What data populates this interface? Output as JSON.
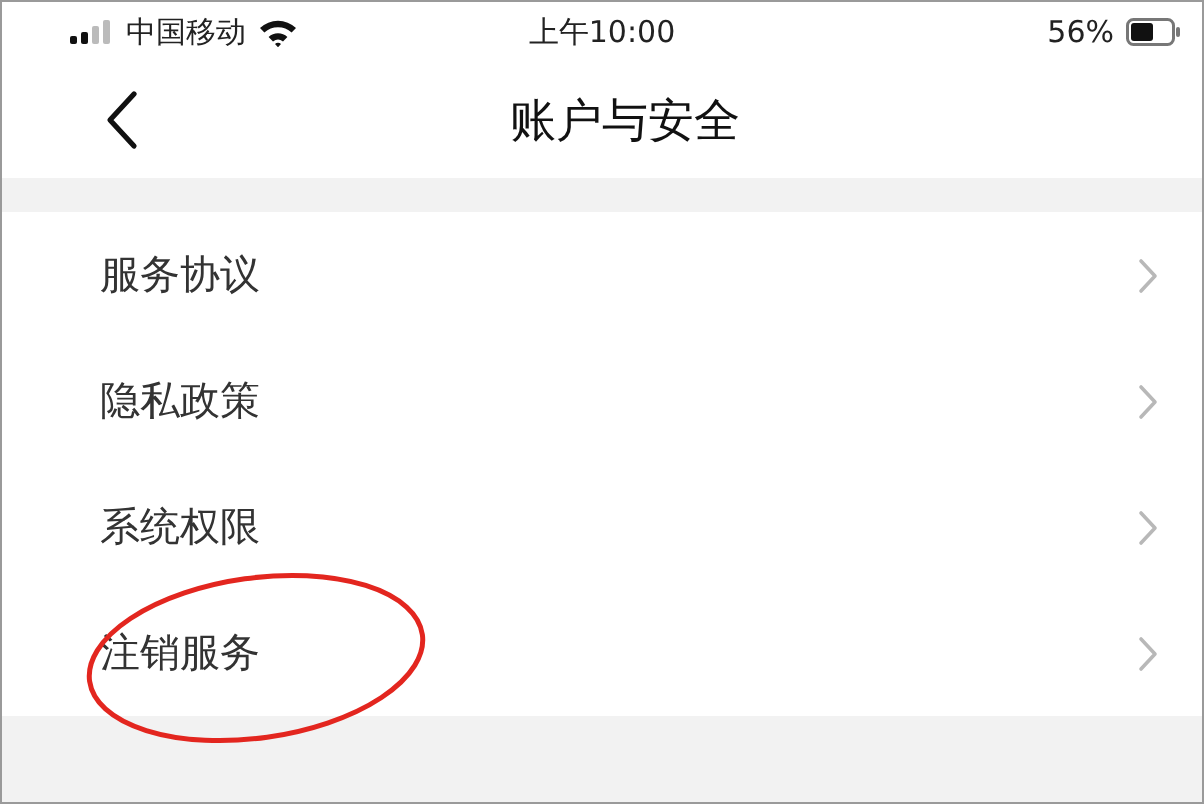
{
  "status_bar": {
    "carrier": "中国移动",
    "time": "上午10:00",
    "battery": "56%"
  },
  "nav": {
    "title": "账户与安全"
  },
  "menu": [
    {
      "label": "服务协议",
      "circled": false
    },
    {
      "label": "隐私政策",
      "circled": false
    },
    {
      "label": "系统权限",
      "circled": false
    },
    {
      "label": "注销服务",
      "circled": true
    }
  ]
}
